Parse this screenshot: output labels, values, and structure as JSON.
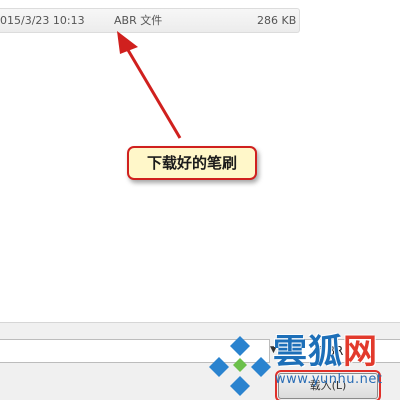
{
  "file_list": {
    "selected_row": {
      "modified": "015/3/23 10:13",
      "type": "ABR 文件",
      "size": "286 KB"
    }
  },
  "annotation": {
    "callout_text": "下载好的笔刷",
    "accent_color": "#d0201e"
  },
  "bottom_panel": {
    "filename_value": "",
    "filetype_value": "笔 BR",
    "load_button_label": "载入(L)"
  },
  "watermark": {
    "brand_part1": "雲狐",
    "brand_part2": "网",
    "url": "www.yunhu.net"
  },
  "icons": {
    "dropdown": "chevron-down-icon",
    "logo": "yunhu-logo-icon"
  }
}
